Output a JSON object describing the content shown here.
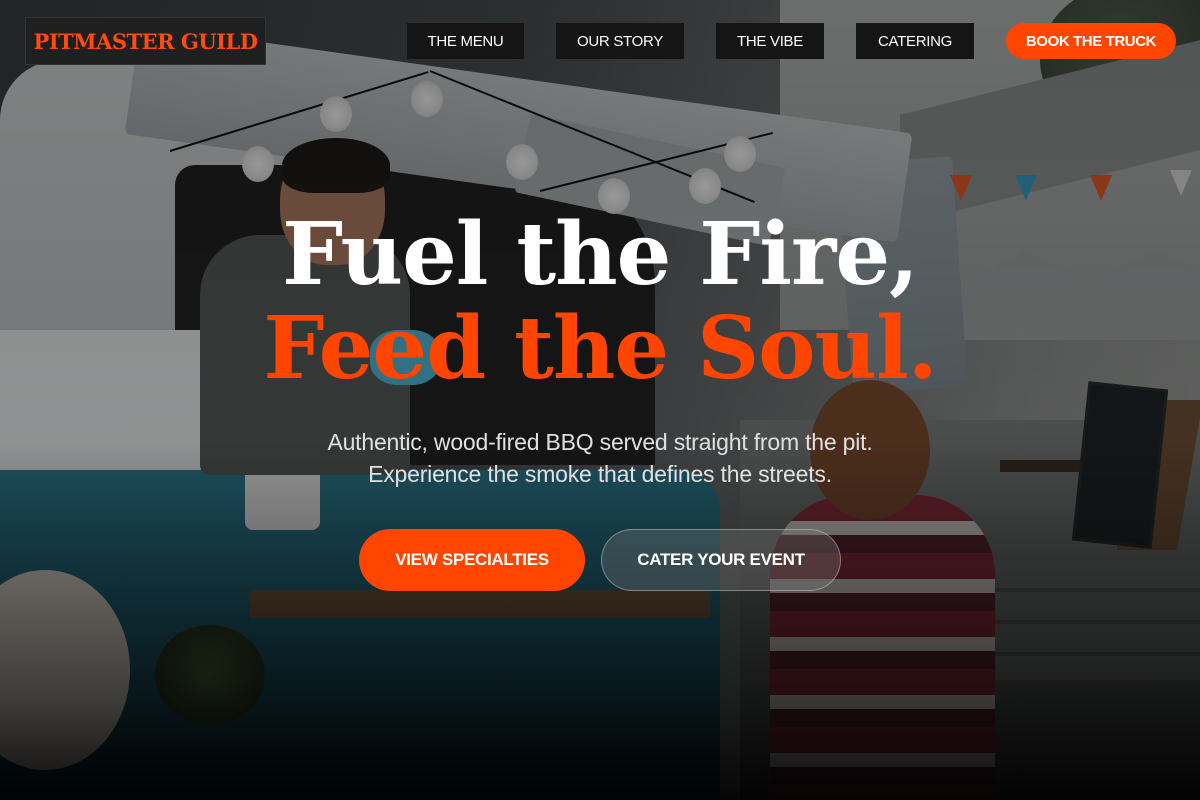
{
  "brand": {
    "name": "PITMASTER GUILD",
    "color": "#ff4b0e"
  },
  "nav": {
    "items": [
      {
        "label": "THE MENU"
      },
      {
        "label": "OUR STORY"
      },
      {
        "label": "THE VIBE"
      },
      {
        "label": "CATERING"
      }
    ],
    "cta_label": "BOOK THE TRUCK"
  },
  "hero": {
    "headline_line1": "Fuel the Fire,",
    "headline_line2": "Feed the Soul.",
    "subtext_line1": "Authentic, wood-fired BBQ served straight from the pit.",
    "subtext_line2": "Experience the smoke that defines the streets.",
    "primary_button": "VIEW SPECIALTIES",
    "secondary_button": "CATER YOUR EVENT",
    "background_image": "food-truck-photo"
  },
  "colors": {
    "accent": "#ff4500",
    "text": "#ffffff",
    "muted": "#e0e0e0",
    "nav_bg": "#151515"
  }
}
